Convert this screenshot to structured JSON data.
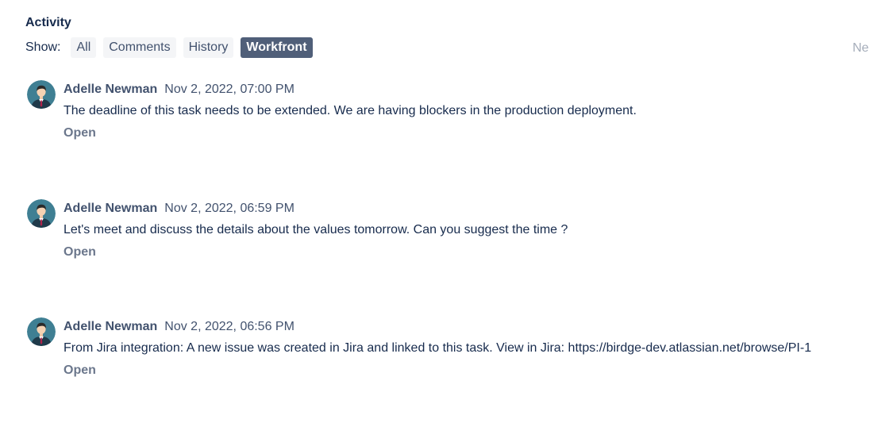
{
  "activity": {
    "title": "Activity",
    "show_label": "Show:",
    "filters": [
      {
        "label": "All",
        "active": false
      },
      {
        "label": "Comments",
        "active": false
      },
      {
        "label": "History",
        "active": false
      },
      {
        "label": "Workfront",
        "active": true
      }
    ],
    "sort_label": "Ne"
  },
  "entries": [
    {
      "author": "Adelle Newman",
      "timestamp": "Nov 2, 2022, 07:00 PM",
      "message": "The deadline of this task needs to be extended. We are having blockers in the production deployment.",
      "action": "Open",
      "avatar_icon": "user-avatar-icon"
    },
    {
      "author": "Adelle Newman",
      "timestamp": "Nov 2, 2022, 06:59 PM",
      "message": "Let's meet and discuss the details about the values tomorrow. Can you suggest the time ?",
      "action": "Open",
      "avatar_icon": "user-avatar-icon"
    },
    {
      "author": "Adelle Newman",
      "timestamp": "Nov 2, 2022, 06:56 PM",
      "message": "From Jira integration: A new issue was created in Jira and linked to this task. View in Jira: https://birdge-dev.atlassian.net/browse/PI-1",
      "action": "Open",
      "avatar_icon": "user-avatar-icon"
    }
  ],
  "colors": {
    "active_filter_bg": "#505f79",
    "filter_bg": "#f4f5f7",
    "avatar_bg": "#3f7f93"
  }
}
